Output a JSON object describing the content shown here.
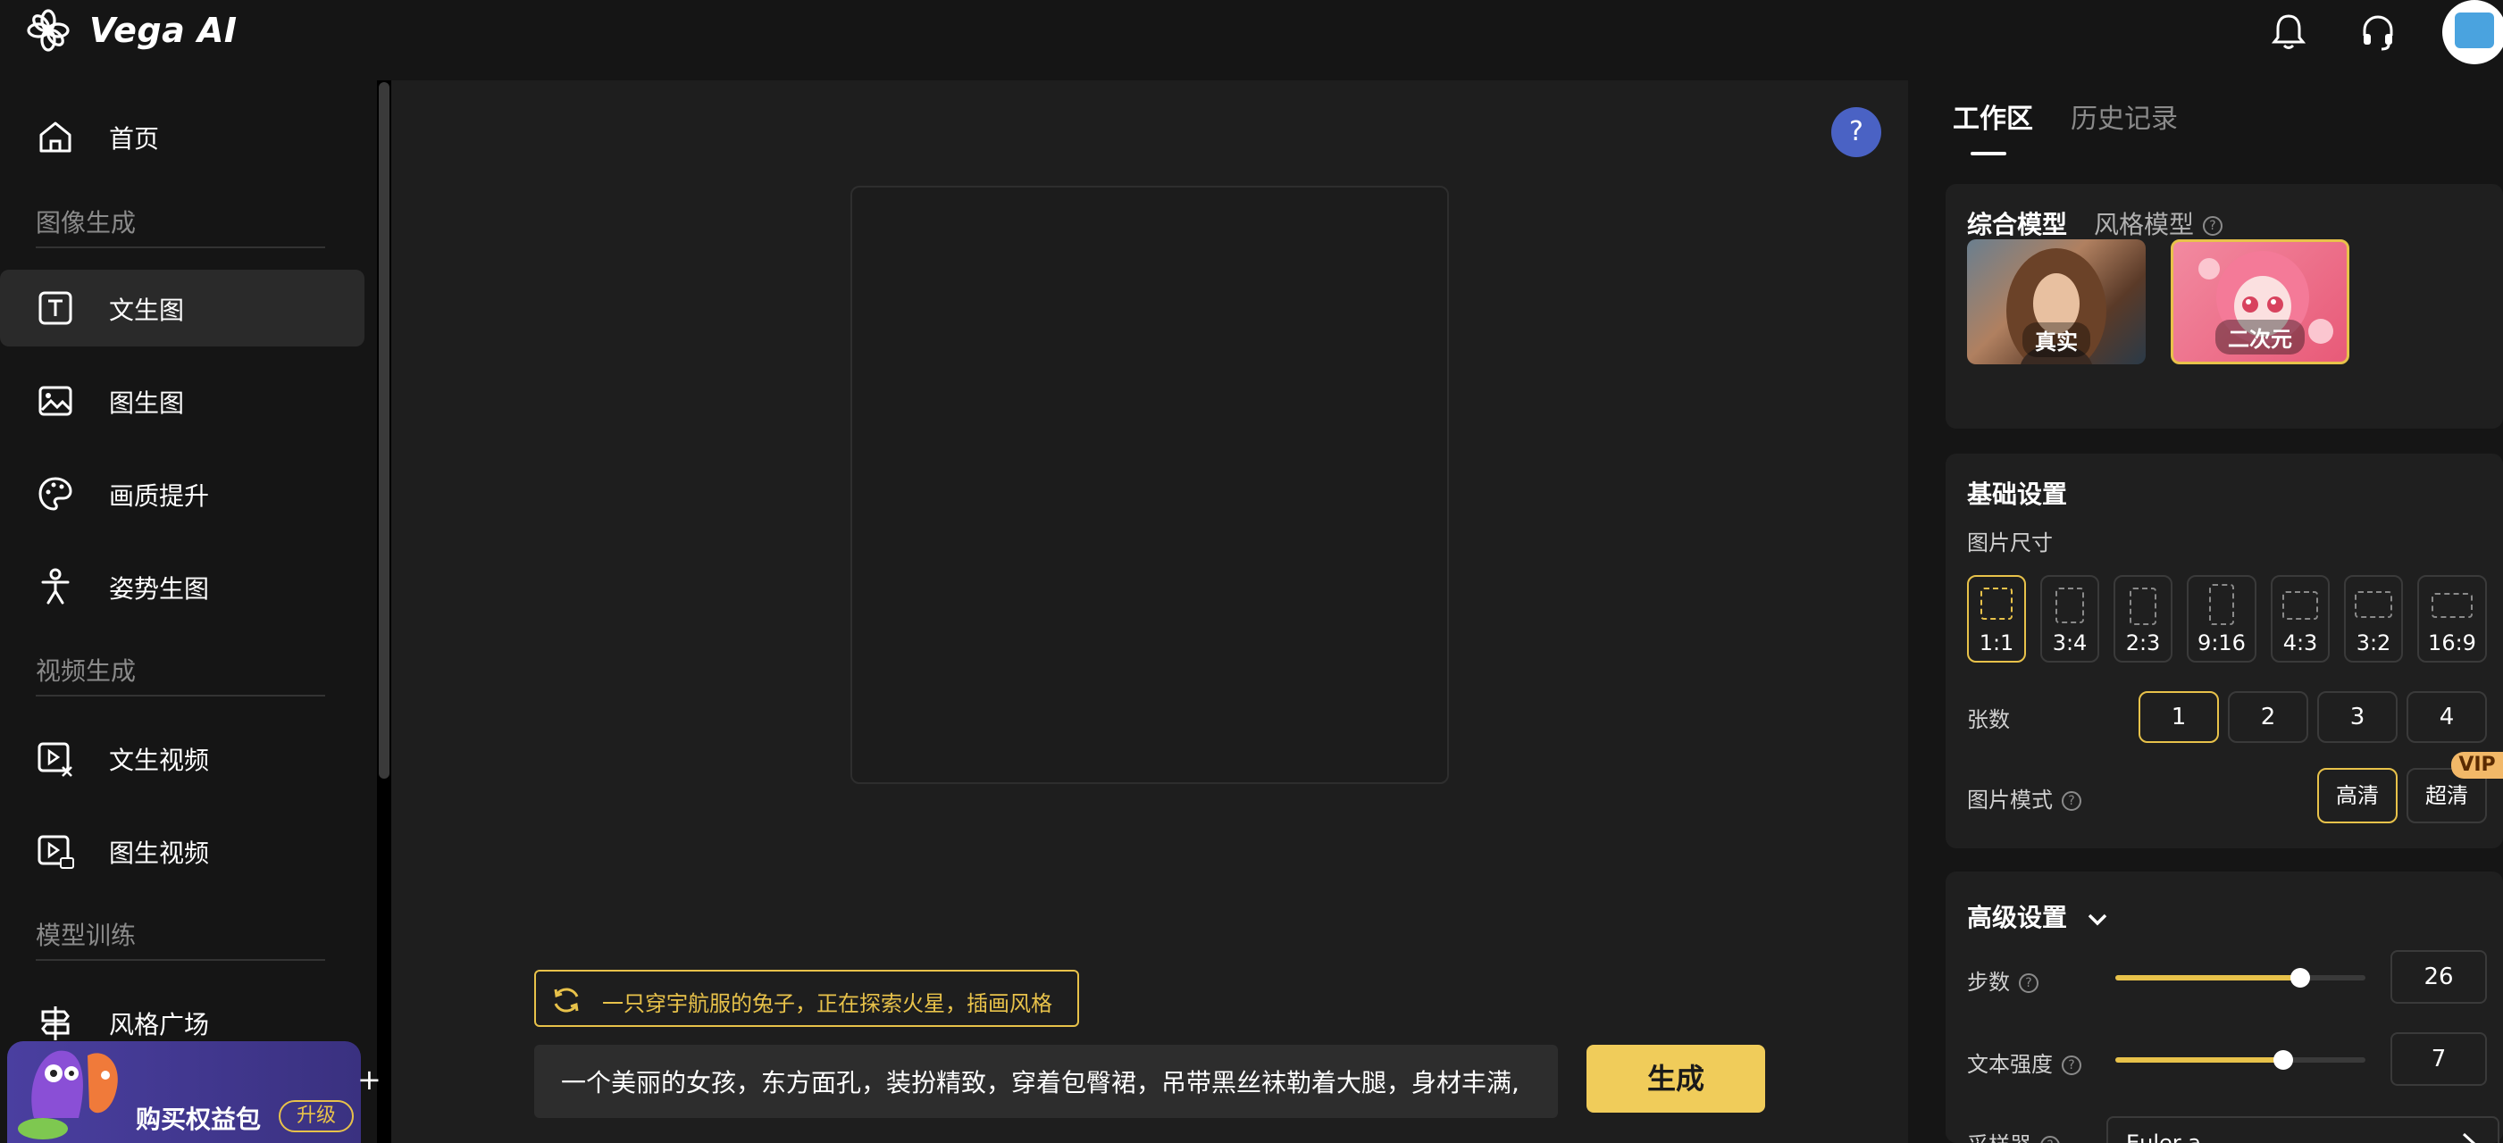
{
  "app": {
    "title": "Vega AI"
  },
  "topbar": {
    "icons": [
      "bell-icon",
      "headset-icon"
    ],
    "avatar": "avatar"
  },
  "sidebar": {
    "home": "首页",
    "sections": [
      {
        "label": "图像生成",
        "items": [
          "文生图",
          "图生图",
          "画质提升",
          "姿势生图"
        ]
      },
      {
        "label": "视频生成",
        "items": [
          "文生视频",
          "图生视频"
        ]
      },
      {
        "label": "模型训练",
        "items": [
          "风格广场"
        ]
      }
    ],
    "active_item": "文生图",
    "promo": {
      "text": "购买权益包",
      "upgrade": "升级"
    }
  },
  "canvas": {
    "help": "?",
    "suggestion": "一只穿宇航服的兔子，正在探索火星，插画风格",
    "prompt_value": "一个美丽的女孩，东方面孔，装扮精致，穿着包臀裙，吊带黑丝袜勒着大腿，身材丰满,",
    "generate_label": "生成"
  },
  "right_panel": {
    "tabs": [
      "工作区",
      "历史记录"
    ],
    "model_tabs": [
      "综合模型",
      "风格模型"
    ],
    "models": [
      {
        "label": "真实",
        "selected": false
      },
      {
        "label": "二次元",
        "selected": true
      }
    ],
    "basic": {
      "title": "基础设置",
      "size_label": "图片尺寸",
      "ratios": [
        "1:1",
        "3:4",
        "2:3",
        "9:16",
        "4:3",
        "3:2",
        "16:9"
      ],
      "selected_ratio": "1:1",
      "count_label": "张数",
      "counts": [
        "1",
        "2",
        "3",
        "4"
      ],
      "selected_count": "1",
      "mode_label": "图片模式",
      "modes": [
        "高清",
        "超清"
      ],
      "selected_mode": "高清",
      "vip": "VIP"
    },
    "advanced": {
      "title": "高级设置",
      "steps_label": "步数",
      "steps_value": "26",
      "steps_fraction": 0.74,
      "strength_label": "文本强度",
      "strength_value": "7",
      "strength_fraction": 0.67,
      "sampler_label": "采样器",
      "sampler_value": "Euler a"
    }
  },
  "colors": {
    "accent": "#e8c24a",
    "button": "#f0cc5a",
    "help": "#4a62c4",
    "promo": "#4a3fa0"
  }
}
